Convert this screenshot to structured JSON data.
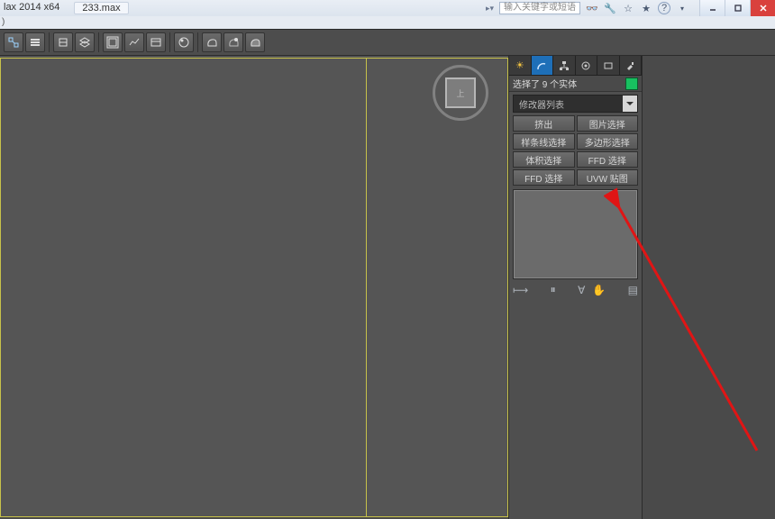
{
  "title_bar": {
    "app": "lax 2014 x64",
    "file": "233.max",
    "search_placeholder": "输入关键字或短语"
  },
  "sub_bar": {
    "paren": ")"
  },
  "right_panel": {
    "selection_info": "选择了 9 个实体",
    "modifier_list_label": "修改器列表",
    "buttons": {
      "extrude": "挤出",
      "img_select": "图片选择",
      "spline_select": "样条线选择",
      "poly_select": "多边形选择",
      "vol_select": "体积选择",
      "ffd_select": "FFD 选择",
      "ffd_select2": "FFD 选择",
      "uvw_map": "UVW 贴图"
    },
    "stack_tools": {
      "pin": "⟼",
      "pause": "⏸",
      "show": "∀",
      "hand": "✋",
      "config": "▤"
    }
  },
  "viewcube": {
    "face": "上"
  }
}
